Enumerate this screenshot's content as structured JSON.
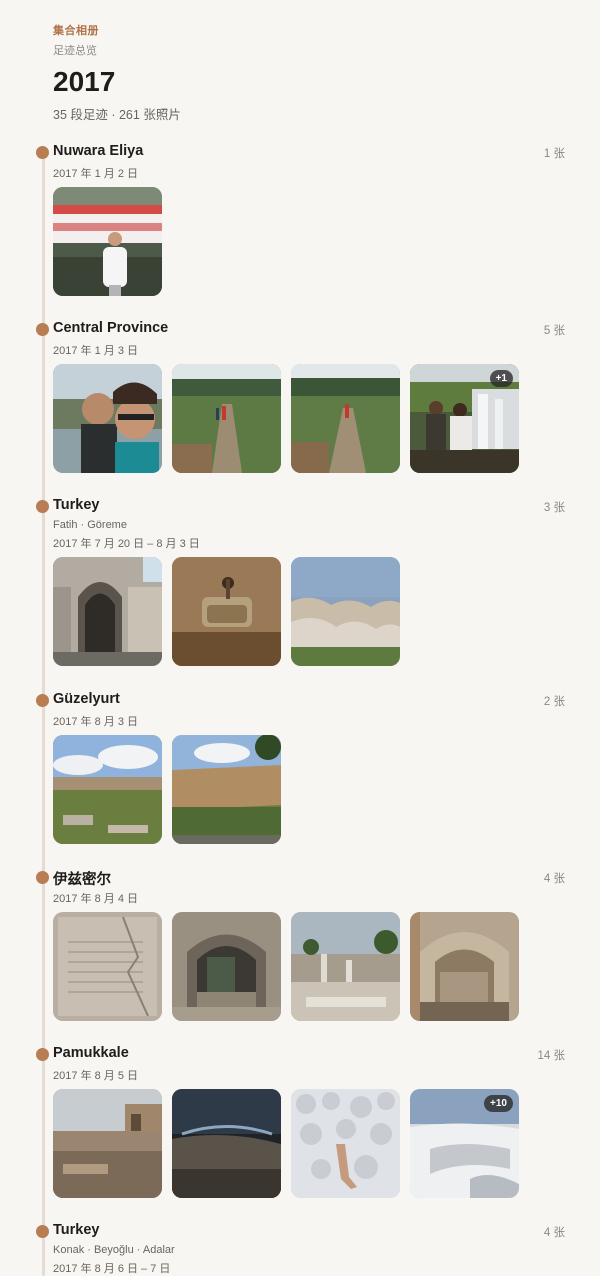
{
  "header": {
    "collection_label": "集合相册",
    "overview_label": "足迹总览",
    "year": "2017",
    "summary": "35 段足迹 · 261 张照片"
  },
  "colors": {
    "accent": "#b87d52",
    "timeline": "#e4dcd4",
    "background": "#f8f6f3"
  },
  "trips": [
    {
      "place": "Nuwara Eliya",
      "count": "1 张",
      "date": "2017 年 1 月 2 日",
      "subplaces": ""
    },
    {
      "place": "Central Province",
      "count": "5 张",
      "date": "2017 年 1 月 3 日",
      "subplaces": "",
      "more": "+1"
    },
    {
      "place": "Turkey",
      "count": "3 张",
      "date": "2017 年 7 月 20 日 – 8 月 3 日",
      "subplaces": "Fatih · Göreme"
    },
    {
      "place": "Güzelyurt",
      "count": "2 张",
      "date": "2017 年 8 月 3 日",
      "subplaces": ""
    },
    {
      "place": "伊兹密尔",
      "count": "4 张",
      "date": "2017 年 8 月 4 日",
      "subplaces": ""
    },
    {
      "place": "Pamukkale",
      "count": "14 张",
      "date": "2017 年 8 月 5 日",
      "subplaces": "",
      "more": "+10"
    },
    {
      "place": "Turkey",
      "count": "4 张",
      "date": "2017 年 8 月 6 日 – 7 日",
      "subplaces": "Konak · Beyoğlu · Adalar"
    }
  ]
}
